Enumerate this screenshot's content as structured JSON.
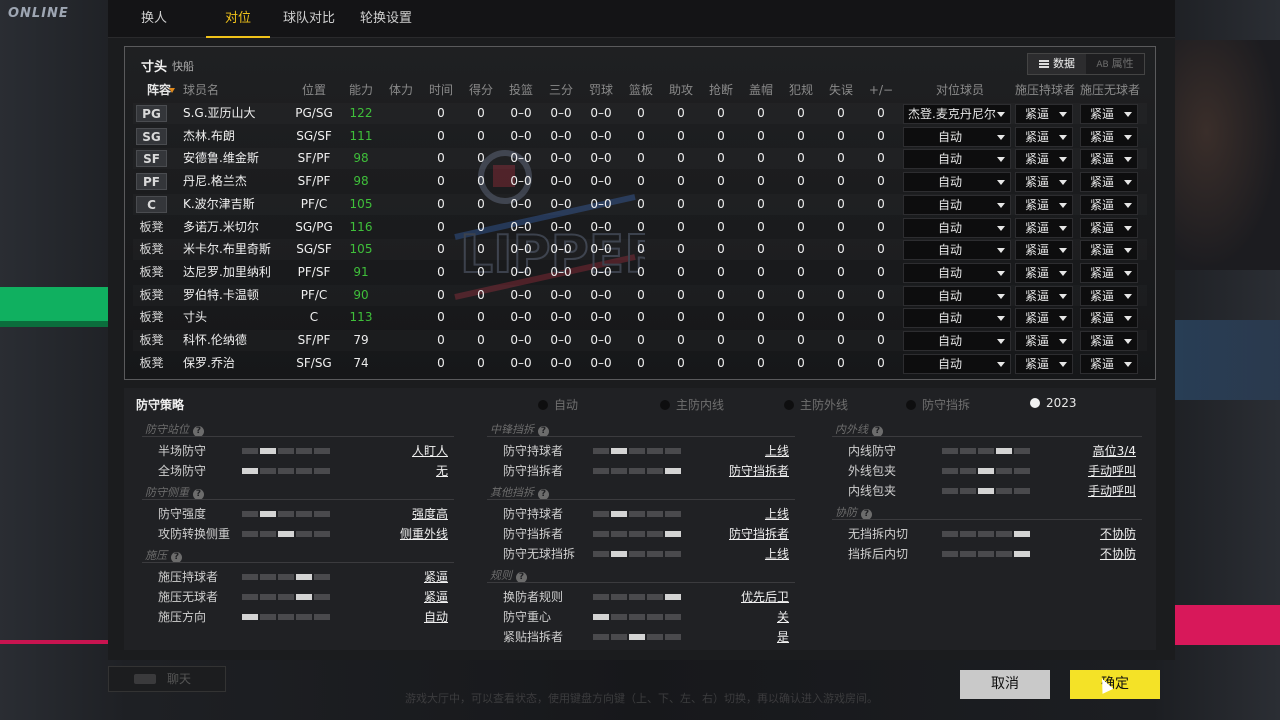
{
  "background": {
    "online_text": "ONLINE"
  },
  "tabs": [
    {
      "label": "换人"
    },
    {
      "label": "对位"
    },
    {
      "label": "球队对比"
    },
    {
      "label": "轮换设置"
    }
  ],
  "active_tab_index": 1,
  "team": {
    "name": "寸头",
    "sub": "快船"
  },
  "view_toggle": {
    "data_label": "数据",
    "data_icon": "list-icon",
    "attr_label": "属性",
    "attr_prefix": "AB"
  },
  "columns": [
    "阵容",
    "球员名",
    "位置",
    "能力",
    "体力",
    "时间",
    "得分",
    "投篮",
    "三分",
    "罚球",
    "篮板",
    "助攻",
    "抢断",
    "盖帽",
    "犯规",
    "失误",
    "+/−",
    "对位球员",
    "施压持球者",
    "施压无球者"
  ],
  "players": [
    {
      "slot": "PG",
      "name": "S.G.亚历山大",
      "pos": "PG/SG",
      "ovr": "122",
      "stamina": "",
      "time": "0",
      "pts": "0",
      "fg": "0–0",
      "three": "0–0",
      "ft": "0–0",
      "reb": "0",
      "ast": "0",
      "stl": "0",
      "blk": "0",
      "pf": "0",
      "to": "0",
      "pm": "0",
      "matchup": "杰登.麦克丹尼尔",
      "press_ball": "紧逼",
      "press_off": "紧逼"
    },
    {
      "slot": "SG",
      "name": "杰林.布朗",
      "pos": "SG/SF",
      "ovr": "111",
      "stamina": "",
      "time": "0",
      "pts": "0",
      "fg": "0–0",
      "three": "0–0",
      "ft": "0–0",
      "reb": "0",
      "ast": "0",
      "stl": "0",
      "blk": "0",
      "pf": "0",
      "to": "0",
      "pm": "0",
      "matchup": "自动",
      "press_ball": "紧逼",
      "press_off": "紧逼"
    },
    {
      "slot": "SF",
      "name": "安德鲁.维金斯",
      "pos": "SF/PF",
      "ovr": "98",
      "stamina": "",
      "time": "0",
      "pts": "0",
      "fg": "0–0",
      "three": "0–0",
      "ft": "0–0",
      "reb": "0",
      "ast": "0",
      "stl": "0",
      "blk": "0",
      "pf": "0",
      "to": "0",
      "pm": "0",
      "matchup": "自动",
      "press_ball": "紧逼",
      "press_off": "紧逼"
    },
    {
      "slot": "PF",
      "name": "丹尼.格兰杰",
      "pos": "SF/PF",
      "ovr": "98",
      "stamina": "",
      "time": "0",
      "pts": "0",
      "fg": "0–0",
      "three": "0–0",
      "ft": "0–0",
      "reb": "0",
      "ast": "0",
      "stl": "0",
      "blk": "0",
      "pf": "0",
      "to": "0",
      "pm": "0",
      "matchup": "自动",
      "press_ball": "紧逼",
      "press_off": "紧逼"
    },
    {
      "slot": "C",
      "name": "K.波尔津吉斯",
      "pos": "PF/C",
      "ovr": "105",
      "stamina": "",
      "time": "0",
      "pts": "0",
      "fg": "0–0",
      "three": "0–0",
      "ft": "0–0",
      "reb": "0",
      "ast": "0",
      "stl": "0",
      "blk": "0",
      "pf": "0",
      "to": "0",
      "pm": "0",
      "matchup": "自动",
      "press_ball": "紧逼",
      "press_off": "紧逼"
    },
    {
      "slot": "板凳",
      "name": "多诺万.米切尔",
      "pos": "SG/PG",
      "ovr": "116",
      "stamina": "",
      "time": "0",
      "pts": "0",
      "fg": "0–0",
      "three": "0–0",
      "ft": "0–0",
      "reb": "0",
      "ast": "0",
      "stl": "0",
      "blk": "0",
      "pf": "0",
      "to": "0",
      "pm": "0",
      "matchup": "自动",
      "press_ball": "紧逼",
      "press_off": "紧逼"
    },
    {
      "slot": "板凳",
      "name": "米卡尔.布里奇斯",
      "pos": "SG/SF",
      "ovr": "105",
      "stamina": "",
      "time": "0",
      "pts": "0",
      "fg": "0–0",
      "three": "0–0",
      "ft": "0–0",
      "reb": "0",
      "ast": "0",
      "stl": "0",
      "blk": "0",
      "pf": "0",
      "to": "0",
      "pm": "0",
      "matchup": "自动",
      "press_ball": "紧逼",
      "press_off": "紧逼"
    },
    {
      "slot": "板凳",
      "name": "达尼罗.加里纳利",
      "pos": "PF/SF",
      "ovr": "91",
      "stamina": "",
      "time": "0",
      "pts": "0",
      "fg": "0–0",
      "three": "0–0",
      "ft": "0–0",
      "reb": "0",
      "ast": "0",
      "stl": "0",
      "blk": "0",
      "pf": "0",
      "to": "0",
      "pm": "0",
      "matchup": "自动",
      "press_ball": "紧逼",
      "press_off": "紧逼"
    },
    {
      "slot": "板凳",
      "name": "罗伯特.卡温顿",
      "pos": "PF/C",
      "ovr": "90",
      "stamina": "",
      "time": "0",
      "pts": "0",
      "fg": "0–0",
      "three": "0–0",
      "ft": "0–0",
      "reb": "0",
      "ast": "0",
      "stl": "0",
      "blk": "0",
      "pf": "0",
      "to": "0",
      "pm": "0",
      "matchup": "自动",
      "press_ball": "紧逼",
      "press_off": "紧逼"
    },
    {
      "slot": "板凳",
      "name": "寸头",
      "pos": "C",
      "ovr": "113",
      "stamina": "",
      "time": "0",
      "pts": "0",
      "fg": "0–0",
      "three": "0–0",
      "ft": "0–0",
      "reb": "0",
      "ast": "0",
      "stl": "0",
      "blk": "0",
      "pf": "0",
      "to": "0",
      "pm": "0",
      "matchup": "自动",
      "press_ball": "紧逼",
      "press_off": "紧逼"
    },
    {
      "slot": "板凳",
      "name": "科怀.伦纳德",
      "pos": "SF/PF",
      "ovr": "79",
      "stamina": "",
      "time": "0",
      "pts": "0",
      "fg": "0–0",
      "three": "0–0",
      "ft": "0–0",
      "reb": "0",
      "ast": "0",
      "stl": "0",
      "blk": "0",
      "pf": "0",
      "to": "0",
      "pm": "0",
      "matchup": "自动",
      "press_ball": "紧逼",
      "press_off": "紧逼"
    },
    {
      "slot": "板凳",
      "name": "保罗.乔治",
      "pos": "SF/SG",
      "ovr": "74",
      "stamina": "",
      "time": "0",
      "pts": "0",
      "fg": "0–0",
      "three": "0–0",
      "ft": "0–0",
      "reb": "0",
      "ast": "0",
      "stl": "0",
      "blk": "0",
      "pf": "0",
      "to": "0",
      "pm": "0",
      "matchup": "自动",
      "press_ball": "紧逼",
      "press_off": "紧逼"
    }
  ],
  "strategy": {
    "title": "防守策略",
    "presets": [
      {
        "label": "自动",
        "selected": false
      },
      {
        "label": "主防内线",
        "selected": false
      },
      {
        "label": "主防外线",
        "selected": false
      },
      {
        "label": "防守挡拆",
        "selected": false
      },
      {
        "label": "2023",
        "selected": true
      }
    ],
    "col1": [
      {
        "section": "防守站位",
        "rows": [
          {
            "label": "半场防守",
            "value": "人盯人",
            "level": 0.2
          },
          {
            "label": "全场防守",
            "value": "无",
            "level": 0.0
          }
        ]
      },
      {
        "section": "防守侧重",
        "rows": [
          {
            "label": "防守强度",
            "value": "强度高",
            "level": 0.2
          },
          {
            "label": "攻防转换侧重",
            "value": "侧重外线",
            "level": 0.6
          }
        ]
      },
      {
        "section": "施压",
        "rows": [
          {
            "label": "施压持球者",
            "value": "紧逼",
            "level": 0.8
          },
          {
            "label": "施压无球者",
            "value": "紧逼",
            "level": 0.8
          },
          {
            "label": "施压方向",
            "value": "自动",
            "level": 0.0
          }
        ]
      }
    ],
    "col2": [
      {
        "section": "中锋挡拆",
        "rows": [
          {
            "label": "防守持球者",
            "value": "上线",
            "level": 0.3
          },
          {
            "label": "防守挡拆者",
            "value": "防守挡拆者",
            "level": 1.0
          }
        ]
      },
      {
        "section": "其他挡拆",
        "rows": [
          {
            "label": "防守持球者",
            "value": "上线",
            "level": 0.3
          },
          {
            "label": "防守挡拆者",
            "value": "防守挡拆者",
            "level": 1.0
          },
          {
            "label": "防守无球挡拆",
            "value": "上线",
            "level": 0.3
          }
        ]
      },
      {
        "section": "规则",
        "rows": [
          {
            "label": "换防者规则",
            "value": "优先后卫",
            "level": 1.0
          },
          {
            "label": "防守重心",
            "value": "关",
            "level": 0.0
          },
          {
            "label": "紧贴挡拆者",
            "value": "是",
            "level": 0.5
          }
        ]
      }
    ],
    "col3": [
      {
        "section": "内外线",
        "rows": [
          {
            "label": "内线防守",
            "value": "高位3/4",
            "level": 0.8
          },
          {
            "label": "外线包夹",
            "value": "手动呼叫",
            "level": 0.5
          },
          {
            "label": "内线包夹",
            "value": "手动呼叫",
            "level": 0.5
          }
        ]
      },
      {
        "section": "协防",
        "rows": [
          {
            "label": "无挡拆内切",
            "value": "不协防",
            "level": 1.0
          },
          {
            "label": "挡拆后内切",
            "value": "不协防",
            "level": 1.0
          }
        ]
      }
    ]
  },
  "buttons": {
    "cancel": "取消",
    "ok": "确定"
  },
  "chat": {
    "label": "聊天"
  },
  "hint": "游戏大厅中，可以查看状态，使用键盘方向键（上、下、左、右）切换，再以确认进入游戏房间。"
}
